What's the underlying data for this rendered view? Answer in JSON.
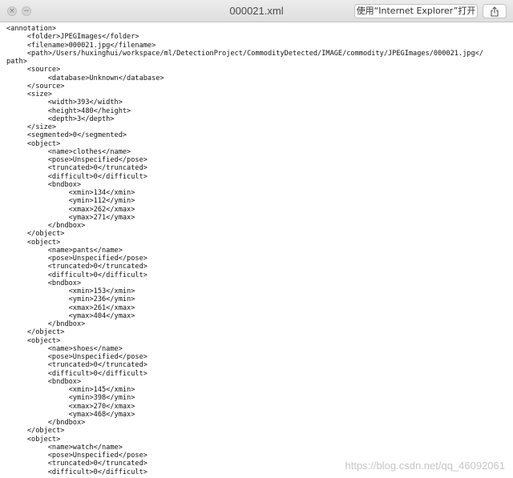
{
  "window": {
    "title": "000021.xml",
    "open_with_label": "使用“Internet Explorer”打开",
    "close_glyph": "×",
    "minimize_glyph": "−"
  },
  "document": {
    "text": "<annotation>\n\t<folder>JPEGImages</folder>\n\t<filename>000021.jpg</filename>\n\t<path>/Users/huxinghui/workspace/ml/DetectionProject/CommodityDetected/IMAGE/commodity/JPEGImages/000021.jpg</\npath>\n\t<source>\n\t\t<database>Unknown</database>\n\t</source>\n\t<size>\n\t\t<width>393</width>\n\t\t<height>480</height>\n\t\t<depth>3</depth>\n\t</size>\n\t<segmented>0</segmented>\n\t<object>\n\t\t<name>clothes</name>\n\t\t<pose>Unspecified</pose>\n\t\t<truncated>0</truncated>\n\t\t<difficult>0</difficult>\n\t\t<bndbox>\n\t\t\t<xmin>134</xmin>\n\t\t\t<ymin>112</ymin>\n\t\t\t<xmax>262</xmax>\n\t\t\t<ymax>271</ymax>\n\t\t</bndbox>\n\t</object>\n\t<object>\n\t\t<name>pants</name>\n\t\t<pose>Unspecified</pose>\n\t\t<truncated>0</truncated>\n\t\t<difficult>0</difficult>\n\t\t<bndbox>\n\t\t\t<xmin>153</xmin>\n\t\t\t<ymin>236</ymin>\n\t\t\t<xmax>261</xmax>\n\t\t\t<ymax>404</ymax>\n\t\t</bndbox>\n\t</object>\n\t<object>\n\t\t<name>shoes</name>\n\t\t<pose>Unspecified</pose>\n\t\t<truncated>0</truncated>\n\t\t<difficult>0</difficult>\n\t\t<bndbox>\n\t\t\t<xmin>145</xmin>\n\t\t\t<ymin>398</ymin>\n\t\t\t<xmax>270</xmax>\n\t\t\t<ymax>468</ymax>\n\t\t</bndbox>\n\t</object>\n\t<object>\n\t\t<name>watch</name>\n\t\t<pose>Unspecified</pose>\n\t\t<truncated>0</truncated>\n\t\t<difficult>0</difficult>"
  },
  "watermark": "https://blog.csdn.net/qq_46092061",
  "icons": {
    "close": "close-icon",
    "minimize": "minimize-icon",
    "share": "share-icon"
  }
}
